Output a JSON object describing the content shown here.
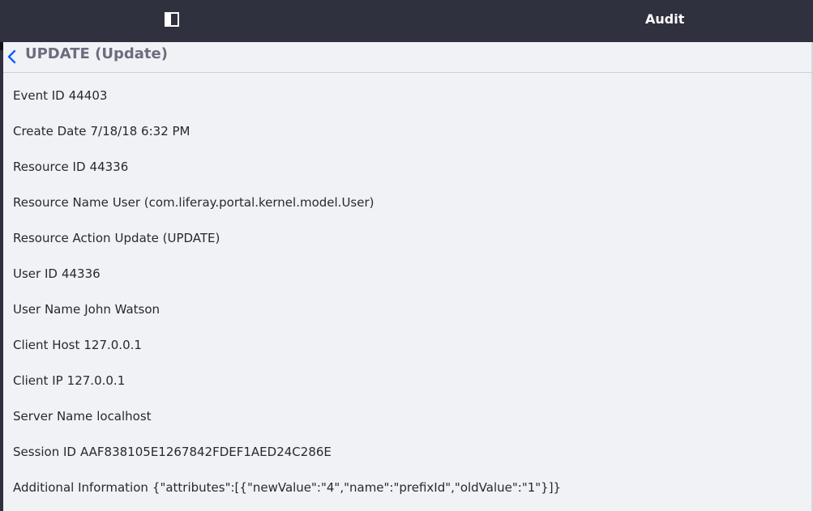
{
  "topbar": {
    "title": "Audit",
    "sidebar_toggle_icon": "sidebar-panel-icon"
  },
  "header": {
    "back_icon": "chevron-left-icon",
    "title": "UPDATE (Update)"
  },
  "details": [
    {
      "label": "Event ID",
      "value": "44403"
    },
    {
      "label": "Create Date",
      "value": "7/18/18 6:32 PM"
    },
    {
      "label": "Resource ID",
      "value": "44336"
    },
    {
      "label": "Resource Name",
      "value": "User (com.liferay.portal.kernel.model.User)"
    },
    {
      "label": "Resource Action",
      "value": "Update (UPDATE)"
    },
    {
      "label": "User ID",
      "value": "44336"
    },
    {
      "label": "User Name",
      "value": "John Watson"
    },
    {
      "label": "Client Host",
      "value": "127.0.0.1"
    },
    {
      "label": "Client IP",
      "value": "127.0.0.1"
    },
    {
      "label": "Server Name",
      "value": "localhost"
    },
    {
      "label": "Session ID",
      "value": "AAF838105E1267842FDEF1AED24C286E"
    },
    {
      "label": "Additional Information",
      "value": "{\"attributes\":[{\"newValue\":\"4\",\"name\":\"prefixId\",\"oldValue\":\"1\"}]}"
    }
  ],
  "colors": {
    "topbar": "#30313f",
    "background": "#f1f2f5",
    "text": "#272833",
    "title": "#6b6c7e",
    "accent": "#0b5fff"
  }
}
